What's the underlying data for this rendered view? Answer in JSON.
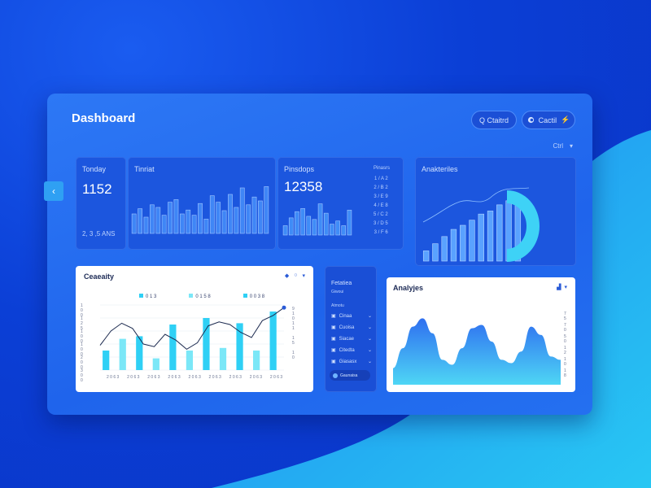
{
  "header": {
    "title": "Dashboard",
    "search_label": "Q Ctaitrd",
    "settings_label": "Cactil",
    "filter_label": "Ctrl"
  },
  "cards": {
    "today": {
      "label": "Tonday",
      "value": "1152",
      "footer": "2, 3 ,5 ANS"
    },
    "trend": {
      "label": "Tinriat"
    },
    "revenue": {
      "label": "Pinsdops",
      "value": "12358",
      "list_title": "Pinasrs",
      "list": [
        "1 / A 2",
        "2 / B 2",
        "3 / E 9",
        "4 / E 8",
        "5 / C 2",
        "3 / D 5",
        "3 / F 6"
      ]
    },
    "analytics_top": {
      "label": "Anakteriles"
    },
    "capacity": {
      "label": "Ceaeaity",
      "legend": [
        "0 1 3",
        "0 1 5 8",
        "0 0 3 8"
      ],
      "yticks": [
        "1 0 0",
        "1 2 5",
        "1 0 0",
        "1 0 0",
        "2 0 0",
        "3 0 0"
      ],
      "xticks": [
        "2 0 6 3",
        "2 0 6 3",
        "2 0 6 3",
        "2 0 6 3",
        "2 0 6 3",
        "2 0 6 3",
        "2 0 6 3",
        "2 0 6 3",
        "2 0 6 3"
      ],
      "right_ticks": [
        "9 1 0",
        "1 1",
        "1 5",
        "1 0"
      ]
    },
    "nav": {
      "title": "Fetatiea",
      "subtitle": "Giwoui",
      "section": "Atmotu",
      "items": [
        "Cinaa",
        "Cuoisa",
        "Siacae",
        "Citedta",
        "Giasasx"
      ],
      "button": "Gaunaisa"
    },
    "analytics": {
      "label": "Analyjes",
      "yticks": [
        "7 5",
        "7 0",
        "5 0",
        "1 2",
        "1 0",
        "1 8"
      ]
    }
  },
  "colors": {
    "background": "#0b3fd6",
    "panel": "#2570f0",
    "card_dark": "#1c56de",
    "accent_cyan": "#2fd0f5",
    "bar_light": "#6fa8ff"
  },
  "chart_data": [
    {
      "type": "bar",
      "name": "trend-bars",
      "values": [
        30,
        38,
        25,
        44,
        40,
        28,
        48,
        52,
        30,
        36,
        28,
        46,
        22,
        58,
        48,
        35,
        60,
        40,
        70,
        44,
        56,
        50,
        72
      ],
      "ylim": [
        0,
        80
      ]
    },
    {
      "type": "bar",
      "name": "revenue-bars",
      "values": [
        12,
        22,
        30,
        34,
        24,
        20,
        40,
        28,
        14,
        18,
        12,
        32
      ],
      "ylim": [
        0,
        50
      ]
    },
    {
      "type": "bar",
      "name": "analytics-top-bars",
      "values": [
        20,
        34,
        48,
        62,
        70,
        80,
        92,
        98,
        110,
        118,
        124
      ],
      "ylim": [
        0,
        140
      ]
    },
    {
      "type": "bar",
      "name": "capacity-bars",
      "values": [
        30,
        48,
        52,
        18,
        70,
        30,
        80,
        34,
        72,
        30,
        90
      ],
      "ylim": [
        0,
        100
      ]
    },
    {
      "type": "line",
      "name": "capacity-line",
      "values": [
        38,
        60,
        72,
        64,
        40,
        36,
        55,
        46,
        32,
        42,
        68,
        74,
        70,
        58,
        50,
        76,
        84,
        96
      ],
      "ylim": [
        0,
        100
      ]
    },
    {
      "type": "area",
      "name": "analytics-area",
      "values": [
        20,
        44,
        70,
        80,
        62,
        30,
        24,
        44,
        68,
        72,
        52,
        30,
        26,
        40,
        70,
        60,
        34,
        30
      ],
      "ylim": [
        0,
        100
      ]
    }
  ]
}
